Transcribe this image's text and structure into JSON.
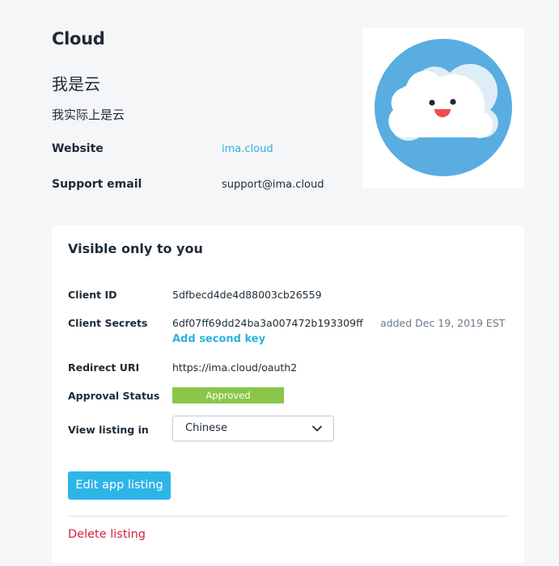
{
  "app": {
    "title": "Cloud",
    "name": "我是云",
    "description": "我实际上是云",
    "website_label": "Website",
    "website_value": "ima.cloud",
    "support_label": "Support email",
    "support_value": "support@ima.cloud",
    "logo_icon": "cloud-face-logo",
    "logo_colors": {
      "circle": "#5aade0",
      "cloud": "#ffffff",
      "cloud_shadow": "#deeef8",
      "mouth": "#f24c4c",
      "eyes": "#1d2b36"
    }
  },
  "private_card": {
    "title": "Visible only to you",
    "client_id_label": "Client ID",
    "client_id": "5dfbecd4de4d88003cb26559",
    "client_secrets_label": "Client Secrets",
    "client_secret": "6df07ff69dd24ba3a007472b193309ff",
    "client_secret_added": "added Dec 19, 2019 EST",
    "add_second_key": "Add second key",
    "redirect_uri_label": "Redirect URI",
    "redirect_uri": "https://ima.cloud/oauth2",
    "approval_status_label": "Approval Status",
    "approval_status": "Approved",
    "view_listing_label": "View listing in",
    "view_listing_value": "Chinese",
    "edit_button": "Edit app listing",
    "delete_link": "Delete listing"
  },
  "colors": {
    "accent": "#2eb5e8",
    "link": "#2eb0de",
    "approved": "#8ac64a",
    "danger": "#d0243d",
    "background": "#f5f6f8"
  }
}
